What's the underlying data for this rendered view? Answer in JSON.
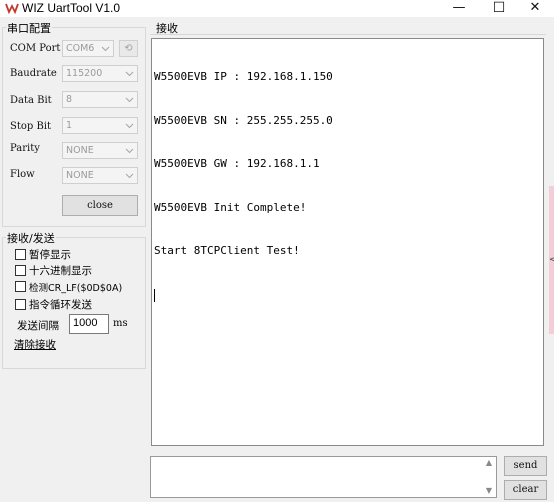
{
  "window": {
    "title": "WIZ UartTool V1.0",
    "minimize": "—",
    "maximize": "☐",
    "close": "✕"
  },
  "serial": {
    "group_title": "串口配置",
    "com_port_label": "COM Port",
    "com_port_value": "COM6",
    "baudrate_label": "Baudrate",
    "baudrate_value": "115200",
    "databit_label": "Data Bit",
    "databit_value": "8",
    "stopbit_label": "Stop Bit",
    "stopbit_value": "1",
    "parity_label": "Parity",
    "parity_value": "NONE",
    "flow_label": "Flow",
    "flow_value": "NONE",
    "close_button": "close"
  },
  "rxtx": {
    "group_title": "接收/发送",
    "pause_display": "暂停显示",
    "hex_display": "十六进制显示",
    "detect_crlf": "检测CR_LF($0D$0A)",
    "loop_send": "指令循环发送",
    "interval_label": "发送间隔",
    "interval_value": "1000",
    "interval_unit": "ms",
    "clear_receive": "清除接收"
  },
  "receive": {
    "title": "接收",
    "lines": [
      "W5500EVB IP : 192.168.1.150",
      "W5500EVB SN : 255.255.255.0",
      "W5500EVB GW : 192.168.1.1",
      "W5500EVB Init Complete!",
      "Start 8TCPClient Test!"
    ]
  },
  "send": {
    "send_button": "send",
    "clear_button": "clear",
    "text": ""
  },
  "side_tab_glyph": "<"
}
